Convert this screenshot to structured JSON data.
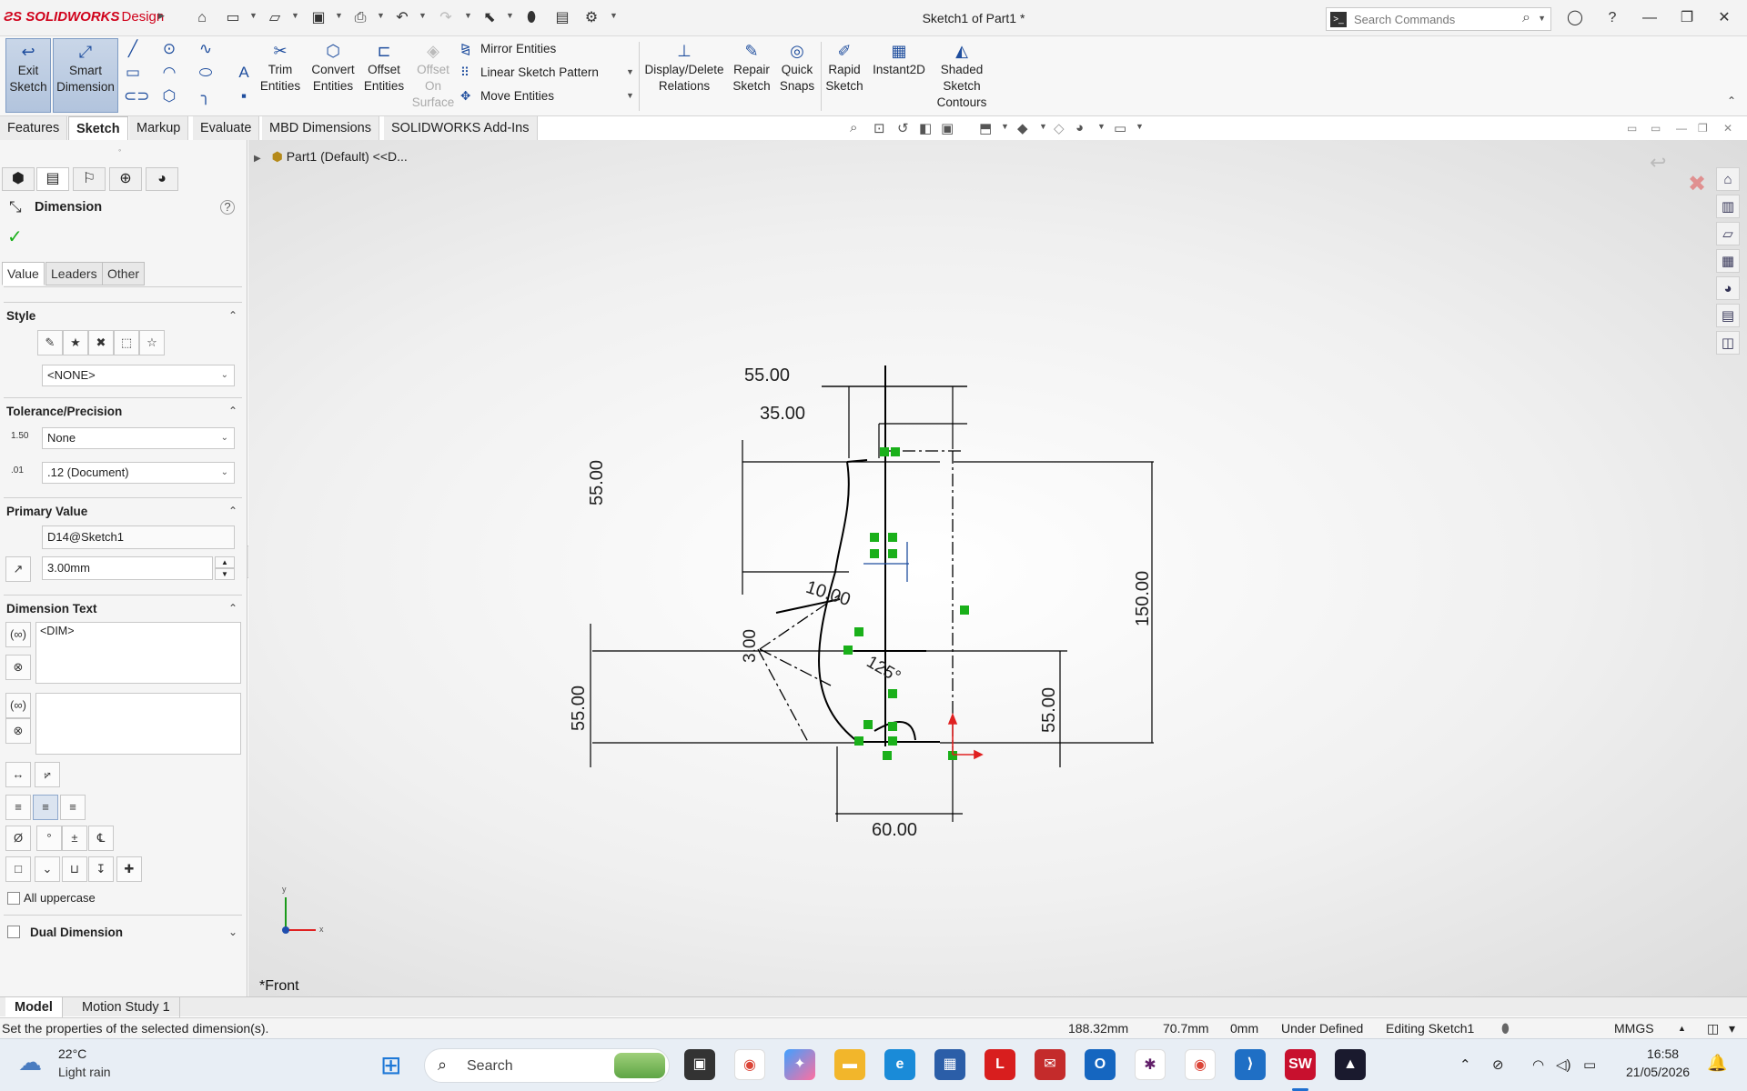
{
  "app": {
    "brand": "SOLIDWORKS",
    "brand_sub": "Design",
    "document_title": "Sketch1 of Part1 *",
    "search_placeholder": "Search Commands"
  },
  "ribbon": {
    "exit_sketch": "Exit\nSketch",
    "smart_dimension": "Smart\nDimension",
    "trim_entities": "Trim\nEntities",
    "convert_entities": "Convert\nEntities",
    "offset_entities": "Offset\nEntities",
    "offset_on_surface": "Offset\nOn\nSurface",
    "mirror_entities": "Mirror Entities",
    "linear_sketch_pattern": "Linear Sketch Pattern",
    "move_entities": "Move Entities",
    "display_delete_relations": "Display/Delete\nRelations",
    "repair_sketch": "Repair\nSketch",
    "quick_snaps": "Quick\nSnaps",
    "rapid_sketch": "Rapid\nSketch",
    "instant2d": "Instant2D",
    "shaded_sketch_contours": "Shaded\nSketch\nContours"
  },
  "command_tabs": [
    "Features",
    "Sketch",
    "Markup",
    "Evaluate",
    "MBD Dimensions",
    "SOLIDWORKS Add-Ins"
  ],
  "property_manager": {
    "title": "Dimension",
    "sub_tabs": [
      "Value",
      "Leaders",
      "Other"
    ],
    "style": {
      "title": "Style",
      "selected": "<NONE>"
    },
    "tolerance": {
      "title": "Tolerance/Precision",
      "tolerance_type": "None",
      "precision": ".12 (Document)"
    },
    "primary_value": {
      "title": "Primary Value",
      "name": "D14@Sketch1",
      "value": "3.00mm"
    },
    "dimension_text": {
      "title": "Dimension Text",
      "text": "<DIM>"
    },
    "all_uppercase": "All uppercase",
    "dual_dimension": "Dual Dimension"
  },
  "graphics": {
    "tree_item": "Part1  (Default) <<D...",
    "view_label": "*Front",
    "triad_x": "x",
    "triad_y": "y",
    "dimensions": {
      "d_55_top": "55.00",
      "d_35": "35.00",
      "d_55_left_upper": "55.00",
      "d_150": "150.00",
      "d_10": "10.00",
      "d_3": "3.00",
      "d_125": "125°",
      "d_55_left_lower": "55.00",
      "d_55_right_lower": "55.00",
      "d_60": "60.00"
    }
  },
  "bottom_tabs": [
    "Model",
    "Motion Study 1"
  ],
  "status": {
    "message": "Set the properties of the selected dimension(s).",
    "x": "188.32mm",
    "y": "70.7mm",
    "z": "0mm",
    "sketch_state": "Under Defined",
    "editing": "Editing Sketch1",
    "units": "MMGS"
  },
  "taskbar": {
    "weather_temp": "22°C",
    "weather_desc": "Light rain",
    "search_label": "Search",
    "time": "16:58",
    "date": "21/05/2026"
  },
  "colors": {
    "brand_red": "#d0021b",
    "relation_green": "#1ab01a",
    "sketch_blue": "#1f4e9e"
  }
}
